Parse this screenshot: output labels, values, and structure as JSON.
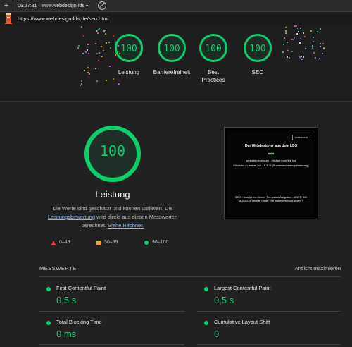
{
  "toolbar": {
    "time_label": "09:27:31 - www.webdesign-lds",
    "add_label": "+"
  },
  "url": {
    "text": "https://www.webdesign-lds.de/seo.html"
  },
  "summary": {
    "categories": [
      {
        "label": "Leistung",
        "score": "100"
      },
      {
        "label": "Barrierefreiheit",
        "score": "100"
      },
      {
        "label": "Best Practices",
        "score": "100"
      },
      {
        "label": "SEO",
        "score": "100"
      }
    ]
  },
  "performance": {
    "score": "100",
    "title": "Leistung",
    "desc_pre": "Die Werte sind geschätzt und können variieren. Die ",
    "desc_link": "Leistungsbewertung",
    "desc_mid": " wird direkt aus diesen Messwerten berechnet. ",
    "desc_link2": "Siehe Rechner.",
    "legend": [
      {
        "shape": "triangle",
        "label": "0–49",
        "color": "#ff3333"
      },
      {
        "shape": "square",
        "label": "50–89",
        "color": "#ffa400"
      },
      {
        "shape": "circle",
        "label": "90–100",
        "color": "#0cce6b"
      }
    ]
  },
  "screenshot": {
    "button": "WEBDESIGN",
    "heading": "Der Webdesigner aus dem LDS",
    "line1": "website developer - Ihr Amt from the lds",
    "line2": "Einblicke in meine Job - S E O (Suchmaschinenoptimierung)",
    "line3": "SEO - Das ist ein kleiner Teil meine Aufgaben - ABER SIE MÜSSEN 'gerade daher' mit in diesem Boot sitzen !!"
  },
  "metrics": {
    "heading": "MESSWERTE",
    "maximize": "Ansicht maximieren",
    "items": [
      {
        "label": "First Contentful Paint",
        "value": "0,5 s"
      },
      {
        "label": "Largest Contentful Paint",
        "value": "0,5 s"
      },
      {
        "label": "Total Blocking Time",
        "value": "0 ms"
      },
      {
        "label": "Cumulative Layout Shift",
        "value": "0"
      }
    ]
  },
  "colors": {
    "pass": "#0cce6b",
    "average": "#ffa400",
    "fail": "#ff3333",
    "link": "#8ab4f8"
  }
}
